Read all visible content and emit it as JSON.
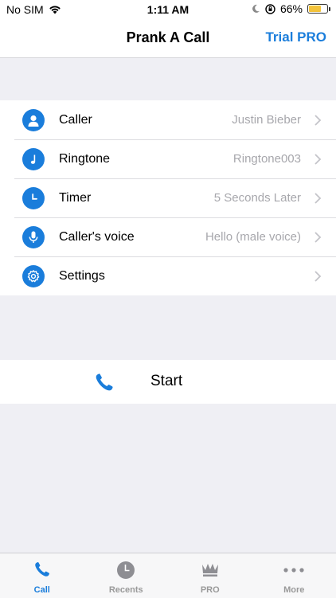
{
  "status_bar": {
    "carrier": "No SIM",
    "time": "1:11 AM",
    "battery": "66%",
    "battery_level": 0.66
  },
  "nav": {
    "title": "Prank A Call",
    "right_action": "Trial PRO"
  },
  "settings_list": [
    {
      "label": "Caller",
      "value": "Justin Bieber",
      "icon": "person-icon"
    },
    {
      "label": "Ringtone",
      "value": "Ringtone003",
      "icon": "music-note-icon"
    },
    {
      "label": "Timer",
      "value": "5 Seconds Later",
      "icon": "clock-icon"
    },
    {
      "label": "Caller's voice",
      "value": "Hello (male voice)",
      "icon": "microphone-icon"
    },
    {
      "label": "Settings",
      "value": "",
      "icon": "gear-icon"
    }
  ],
  "start": {
    "label": "Start",
    "icon": "phone-icon"
  },
  "tabs": [
    {
      "label": "Call",
      "icon": "phone-icon",
      "active": true
    },
    {
      "label": "Recents",
      "icon": "clock-icon",
      "active": false
    },
    {
      "label": "PRO",
      "icon": "crown-icon",
      "active": false
    },
    {
      "label": "More",
      "icon": "more-dots-icon",
      "active": false
    }
  ],
  "colors": {
    "accent": "#1a7ddb",
    "background": "#efeff4",
    "secondary_text": "#a7a7ac",
    "battery": "#f3c33b"
  }
}
